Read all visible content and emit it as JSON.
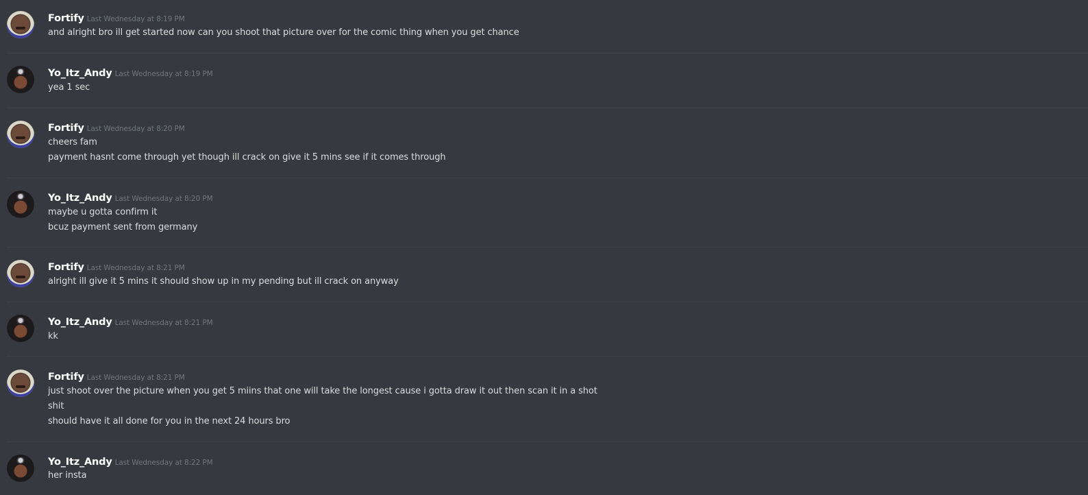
{
  "messages": [
    {
      "author": "Fortify",
      "timestamp": "Last Wednesday at 8:19 PM",
      "lines": [
        "and alright bro ill get started now can you shoot that picture over for the comic thing when you get chance"
      ]
    },
    {
      "author": "Yo_Itz_Andy",
      "timestamp": "Last Wednesday at 8:19 PM",
      "lines": [
        "yea 1 sec"
      ]
    },
    {
      "author": "Fortify",
      "timestamp": "Last Wednesday at 8:20 PM",
      "lines": [
        "cheers fam",
        "payment hasnt come through yet though ill crack on give it 5 mins see if it comes through"
      ]
    },
    {
      "author": "Yo_Itz_Andy",
      "timestamp": "Last Wednesday at 8:20 PM",
      "lines": [
        "maybe u gotta confirm it",
        "bcuz payment sent from germany"
      ]
    },
    {
      "author": "Fortify",
      "timestamp": "Last Wednesday at 8:21 PM",
      "lines": [
        "alright ill give it 5 mins it should show up in my pending but ill crack on anyway"
      ]
    },
    {
      "author": "Yo_Itz_Andy",
      "timestamp": "Last Wednesday at 8:21 PM",
      "lines": [
        "kk"
      ]
    },
    {
      "author": "Fortify",
      "timestamp": "Last Wednesday at 8:21 PM",
      "lines": [
        "just shoot over the picture when you get 5 miins that one will take the longest cause i gotta draw it out then scan it in a shot",
        "shit",
        "should have it all done for you in the next 24 hours bro"
      ]
    },
    {
      "author": "Yo_Itz_Andy",
      "timestamp": "Last Wednesday at 8:22 PM",
      "lines": [
        "her insta"
      ]
    }
  ],
  "colors": {
    "background": "#36393f",
    "username": "#ffffff",
    "timestamp": "#72767d",
    "text": "#dcddde",
    "divider": "#40444b",
    "link": "#00b0f4"
  }
}
